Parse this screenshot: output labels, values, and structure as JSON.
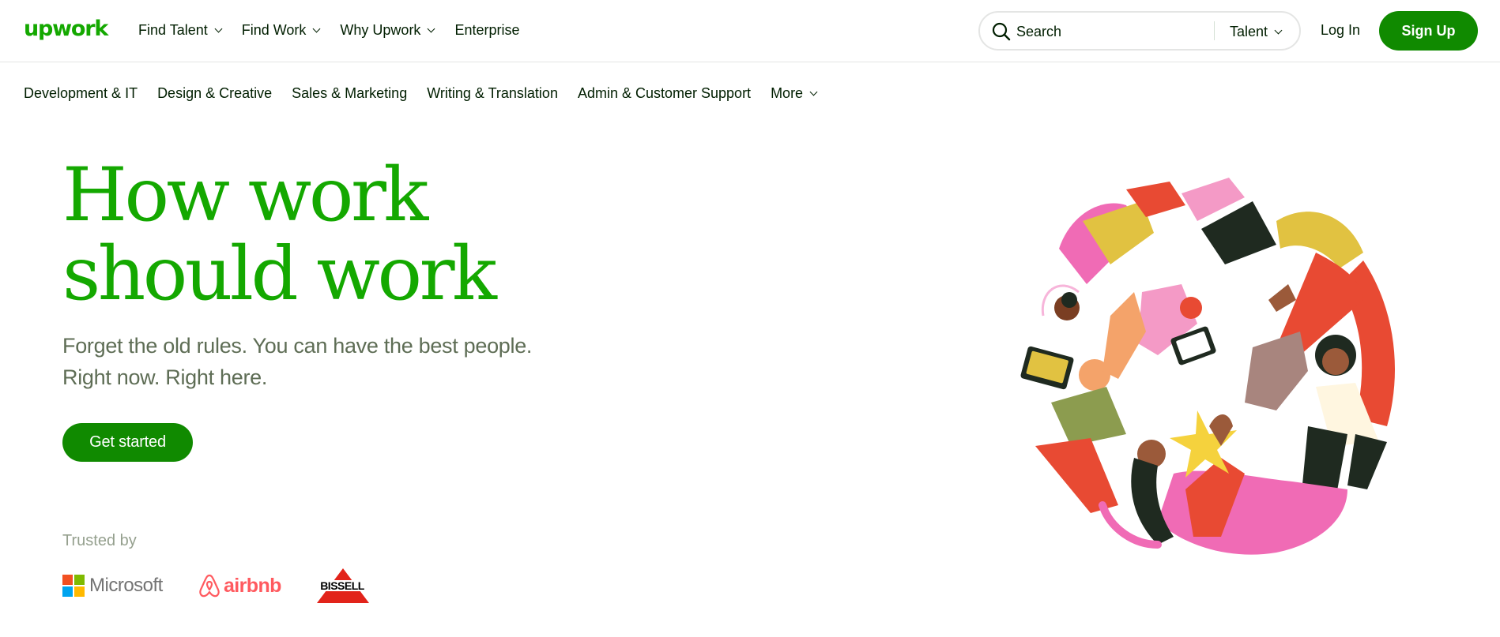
{
  "brand": {
    "logo_text": "upwork",
    "accent": "#14a800",
    "button_green": "#108a00"
  },
  "topnav": {
    "items": [
      {
        "label": "Find Talent",
        "dropdown": true
      },
      {
        "label": "Find Work",
        "dropdown": true
      },
      {
        "label": "Why Upwork",
        "dropdown": true
      },
      {
        "label": "Enterprise",
        "dropdown": false
      }
    ],
    "search": {
      "placeholder": "Search",
      "category": "Talent"
    },
    "login_label": "Log In",
    "signup_label": "Sign Up"
  },
  "categories": [
    "Development & IT",
    "Design & Creative",
    "Sales & Marketing",
    "Writing & Translation",
    "Admin & Customer Support",
    "More"
  ],
  "hero": {
    "headline_line1": "How work",
    "headline_line2": "should work",
    "sub_line1": "Forget the old rules. You can have the best people.",
    "sub_line2": "Right now. Right here.",
    "cta_label": "Get started",
    "trusted_label": "Trusted by",
    "brands": [
      {
        "name": "Microsoft",
        "icon": "microsoft-logo-icon"
      },
      {
        "name": "airbnb",
        "icon": "airbnb-logo-icon"
      },
      {
        "name": "BISSELL",
        "icon": "bissell-logo-icon"
      }
    ]
  },
  "illustration": {
    "icon": "people-collaborating-illustration"
  }
}
